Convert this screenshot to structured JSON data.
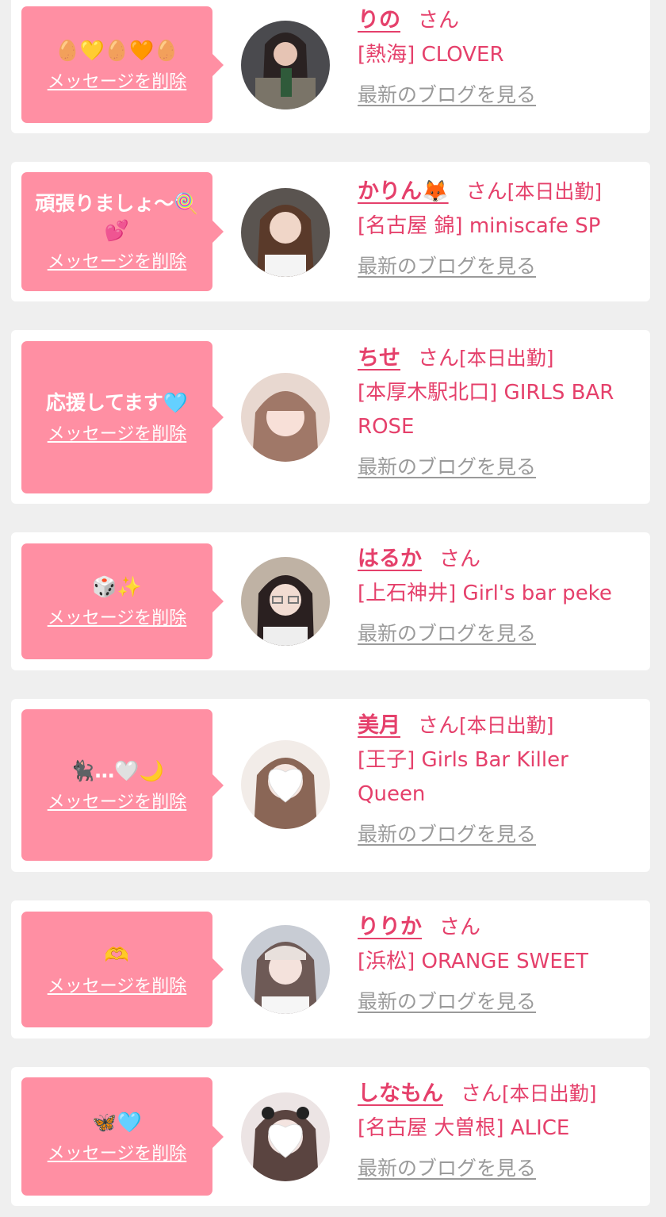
{
  "delete_label": "メッセージを削除",
  "honorific": "さん",
  "blog_label": "最新のブログを見る",
  "colors": {
    "bubble": "#ff8fa3",
    "name": "#e5406b",
    "blog_link": "#9a9a9a",
    "background": "#efefef",
    "card": "#ffffff"
  },
  "favorites": [
    {
      "message": "🥚💛🥚🧡🥚",
      "name": "りの",
      "tag": "",
      "shop": "[熱海] CLOVER"
    },
    {
      "message": "頑張りましょ〜🍭\n💕",
      "name": "かりん🦊",
      "tag": "[本日出勤]",
      "shop": "[名古屋 錦] miniscafe SP"
    },
    {
      "message": "応援してます🩵",
      "name": "ちせ",
      "tag": "[本日出勤]",
      "shop": "[本厚木駅北口] GIRLS BAR ROSE"
    },
    {
      "message": "🎲✨",
      "name": "はるか",
      "tag": "",
      "shop": "[上石神井] Girl's bar peke"
    },
    {
      "message": "🐈‍⬛…🤍🌙",
      "name": "美月",
      "tag": "[本日出勤]",
      "shop": "[王子] Girls Bar Killer Queen"
    },
    {
      "message": "🫶",
      "name": "りりか",
      "tag": "",
      "shop": "[浜松] ORANGE SWEET"
    },
    {
      "message": "🦋🩵",
      "name": "しなもん",
      "tag": "[本日出勤]",
      "shop": "[名古屋 大曽根] ALICE"
    }
  ]
}
